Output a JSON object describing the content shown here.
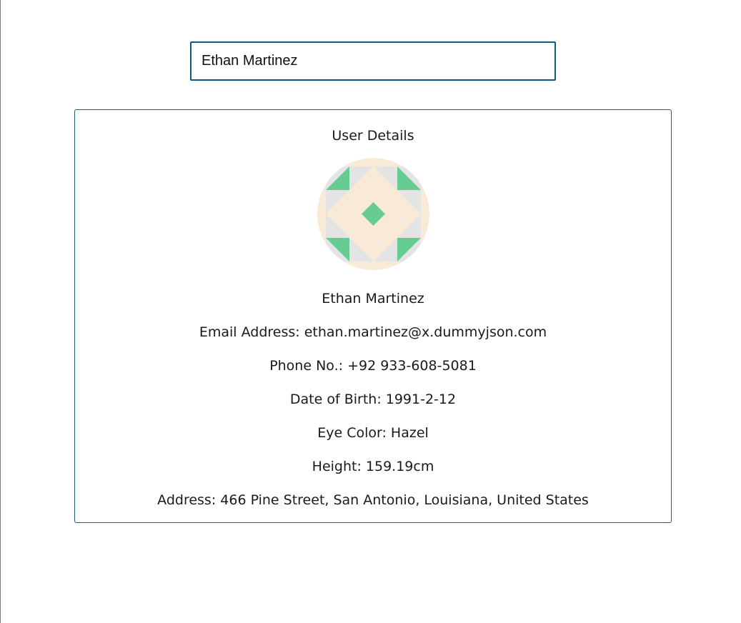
{
  "search": {
    "value": "Ethan Martinez"
  },
  "card": {
    "title": "User Details",
    "avatar_icon": "identicon-avatar",
    "name": "Ethan Martinez",
    "email": "Email Address: ethan.martinez@x.dummyjson.com",
    "phone": "Phone No.: +92 933-608-5081",
    "birth_date": "Date of Birth: 1991-2-12",
    "eye_color": "Eye Color: Hazel",
    "height": "Height: 159.19cm",
    "address": "Address: 466 Pine Street, San Antonio, Louisiana, United States"
  },
  "colors": {
    "accent": "#0e5a84",
    "card_border": "#1f5e7e",
    "avatar_bg": "#f9ead7",
    "avatar_green": "#66cc91",
    "avatar_gray": "#e4e4e4"
  }
}
